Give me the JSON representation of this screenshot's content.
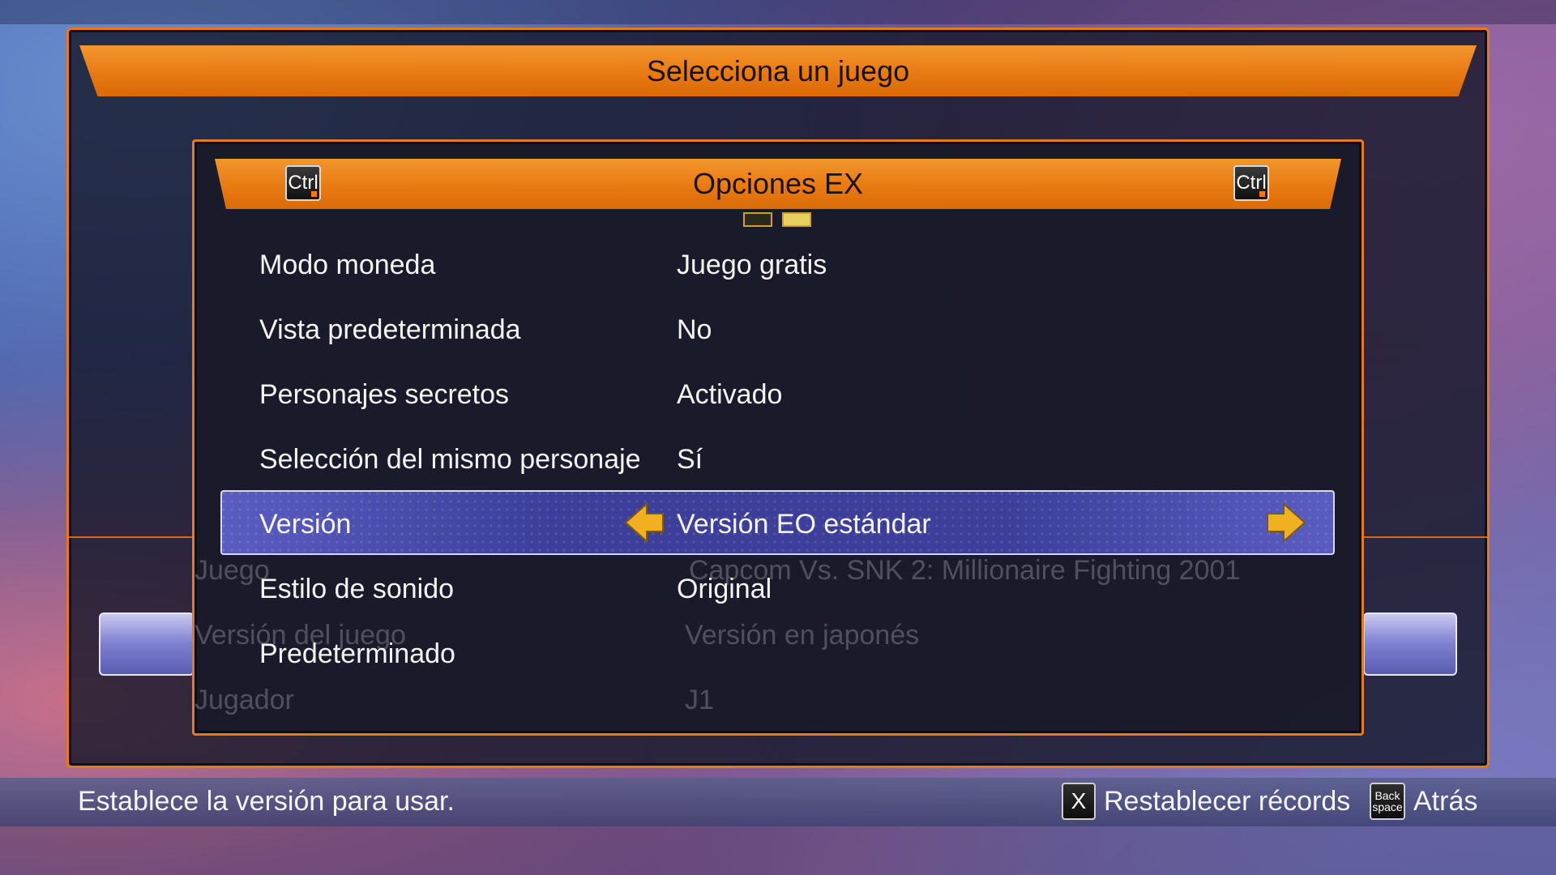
{
  "header": {
    "title": "Selecciona un juego"
  },
  "background_rows": {
    "game_label": "Juego",
    "game_value": "Capcom Vs. SNK 2: Millionaire Fighting 2001",
    "version_label": "Versión del juego",
    "version_value": "Versión en japonés",
    "player_label": "Jugador",
    "player_value": "J1"
  },
  "dialog": {
    "title": "Opciones EX",
    "prev_key": "Ctrl",
    "next_key": "Ctrl",
    "page_count": 2,
    "active_page": 2,
    "options": [
      {
        "label": "Modo moneda",
        "value": "Juego gratis"
      },
      {
        "label": "Vista predeterminada",
        "value": "No"
      },
      {
        "label": "Personajes secretos",
        "value": "Activado"
      },
      {
        "label": "Selección del mismo personaje",
        "value": "Sí"
      },
      {
        "label": "Versión",
        "value": "Versión EO estándar"
      },
      {
        "label": "Estilo de sonido",
        "value": "Original"
      },
      {
        "label": "Predeterminado",
        "value": ""
      }
    ],
    "selected_index": 4
  },
  "footer": {
    "hint": "Establece la versión para usar.",
    "reset_key": "X",
    "reset_label": "Restablecer récords",
    "back_key": "Back space",
    "back_label": "Atrás"
  },
  "colors": {
    "accent_orange": "#e97a12",
    "selection_blue": "#3c3e9a",
    "arrow_yellow": "#f0b020"
  }
}
